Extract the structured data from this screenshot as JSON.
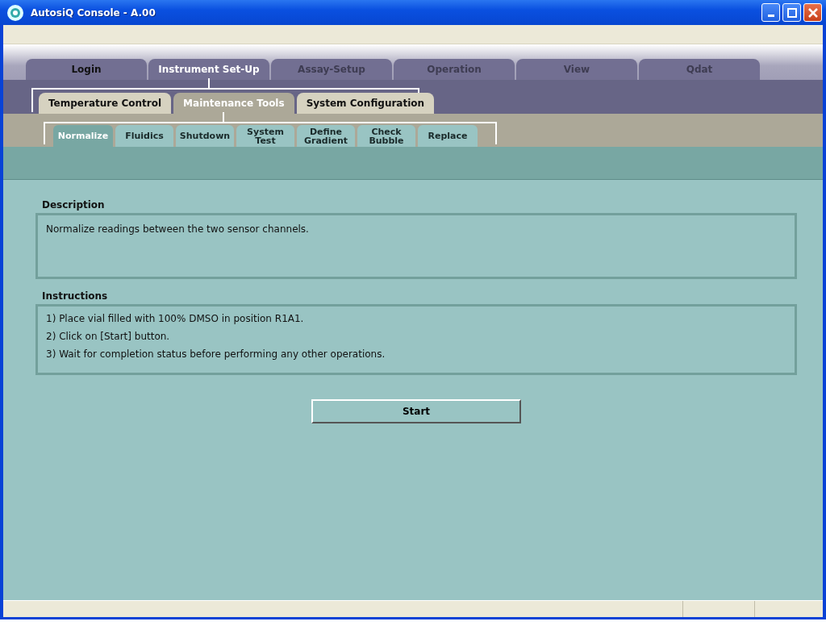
{
  "window": {
    "title": "AutosiQ Console - A.00"
  },
  "main_tabs": [
    {
      "label": "Login",
      "selected": false,
      "disabled": false
    },
    {
      "label": "Instrument Set-Up",
      "selected": true,
      "disabled": false
    },
    {
      "label": "Assay-Setup",
      "selected": false,
      "disabled": true
    },
    {
      "label": "Operation",
      "selected": false,
      "disabled": true
    },
    {
      "label": "View",
      "selected": false,
      "disabled": true
    },
    {
      "label": "Qdat",
      "selected": false,
      "disabled": true
    }
  ],
  "sub_tabs": [
    {
      "label": "Temperature Control",
      "selected": false
    },
    {
      "label": "Maintenance Tools",
      "selected": true
    },
    {
      "label": "System Configuration",
      "selected": false
    }
  ],
  "tool_tabs": [
    {
      "label": "Normalize",
      "selected": true
    },
    {
      "label": "Fluidics",
      "selected": false
    },
    {
      "label": "Shutdown",
      "selected": false
    },
    {
      "label": "System Test",
      "selected": false
    },
    {
      "label": "Define Gradient",
      "selected": false
    },
    {
      "label": "Check Bubble",
      "selected": false
    },
    {
      "label": "Replace",
      "selected": false
    }
  ],
  "description": {
    "heading": "Description",
    "text": "Normalize readings between the two sensor channels."
  },
  "instructions": {
    "heading": "Instructions",
    "steps": [
      "1) Place vial filled with 100% DMSO in position R1A1.",
      "2) Click on [Start] button.",
      "3) Wait for completion status before performing any other operations."
    ]
  },
  "start_button": "Start"
}
